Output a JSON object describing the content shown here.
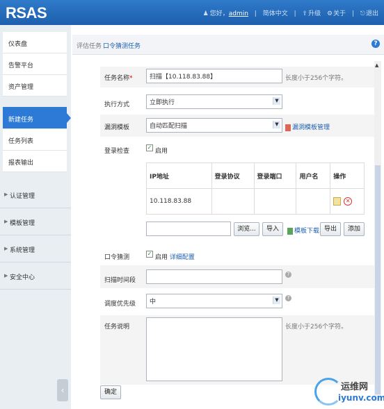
{
  "app": {
    "logo": "RSAS"
  },
  "topbar": {
    "greeting": "您好，",
    "user": "admin",
    "lang": "简体中文",
    "upgrade": "升级",
    "about": "关于",
    "logout": "退出"
  },
  "sidebar": {
    "group1": [
      "仪表盘",
      "告警平台",
      "资产管理"
    ],
    "active": "新建任务",
    "group2": [
      "任务列表",
      "报表输出"
    ],
    "sections": [
      "认证管理",
      "模板管理",
      "系统管理",
      "安全中心"
    ]
  },
  "tabs": {
    "tab1": "评估任务",
    "tab2": "口令猜测任务"
  },
  "form": {
    "task_name_label": "任务名称",
    "task_name_required": "*",
    "task_name_value": "扫描【10.118.83.88】",
    "task_name_hint": "长度小于256个字符。",
    "exec_label": "执行方式",
    "exec_value": "立即执行",
    "vuln_label": "漏洞模板",
    "vuln_value": "自动匹配扫描",
    "vuln_manage_link": "漏洞模板管理",
    "login_label": "登录检查",
    "login_enable": "启用",
    "table_headers": [
      "IP地址",
      "登录协议",
      "登录端口",
      "用户名",
      "操作"
    ],
    "table_rows": [
      {
        "ip": "10.118.83.88",
        "protocol": "",
        "port": "",
        "user": ""
      }
    ],
    "browse_btn": "浏览...",
    "import_btn": "导入",
    "template_download": "模板下载",
    "export_btn": "导出",
    "add_btn": "添加",
    "pwd_label": "口令猜测",
    "pwd_enable": "启用",
    "pwd_config_link": "详细配置",
    "period_label": "扫描时间段",
    "priority_label": "调度优先级",
    "priority_value": "中",
    "desc_label": "任务说明",
    "desc_hint": "长度小于256个字符。",
    "submit_btn": "确定"
  },
  "watermark": {
    "cn": "运维网",
    "url": "iyunv.com"
  }
}
